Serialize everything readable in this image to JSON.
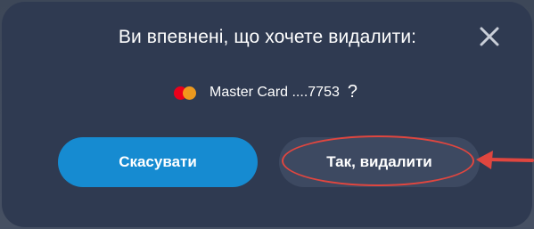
{
  "dialog": {
    "title": "Ви впевнені, що хочете видалити:",
    "close_icon": "close-icon",
    "card": {
      "brand_icon": "mastercard-logo-icon",
      "label": "Master Card ....7753",
      "question_mark": "?"
    },
    "buttons": {
      "cancel_label": "Скасувати",
      "confirm_label": "Так, видалити"
    }
  },
  "annotation": {
    "highlight_color": "#e0463f",
    "shapes": [
      "ellipse",
      "arrow"
    ]
  },
  "colors": {
    "modal_bg": "#2f3a51",
    "cancel_bg": "#168bd1",
    "confirm_bg": "#3d4961",
    "mastercard_red": "#eb001b",
    "mastercard_orange": "#f79e1b"
  }
}
